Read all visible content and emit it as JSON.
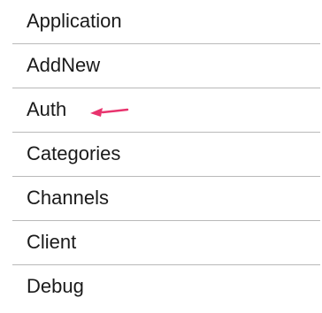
{
  "menu": {
    "items": [
      {
        "label": "Application"
      },
      {
        "label": "AddNew"
      },
      {
        "label": "Auth"
      },
      {
        "label": "Categories"
      },
      {
        "label": "Channels"
      },
      {
        "label": "Client"
      },
      {
        "label": "Debug"
      }
    ],
    "highlighted_index": 2
  },
  "annotation": {
    "arrow_color": "#e8336d",
    "arrow_icon": "left-arrow-icon"
  },
  "colors": {
    "divider": "#b9b9b9",
    "text": "#1a1a1a"
  }
}
